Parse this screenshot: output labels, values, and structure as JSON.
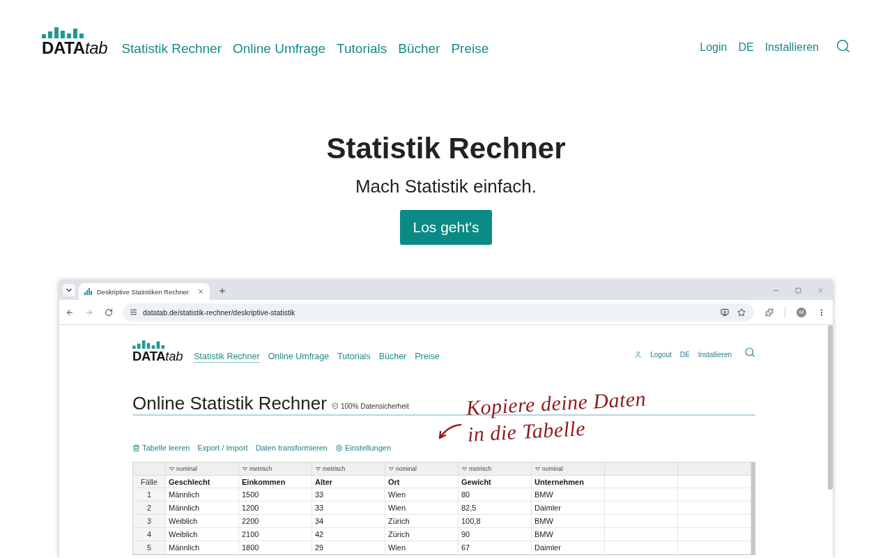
{
  "header": {
    "logo": {
      "bold": "DATA",
      "italic": "tab"
    },
    "nav": [
      "Statistik Rechner",
      "Online Umfrage",
      "Tutorials",
      "Bücher",
      "Preise"
    ],
    "links": [
      "Login",
      "DE",
      "Installieren"
    ]
  },
  "hero": {
    "title": "Statistik Rechner",
    "subtitle": "Mach Statistik einfach.",
    "button": "Los geht's"
  },
  "preview": {
    "browser": {
      "tab_title": "Deskriptive Statistiken Rechner",
      "url": "datatab.de/statistik-rechner/deskriptive-statistik",
      "avatar": "M"
    },
    "page": {
      "logo": {
        "bold": "DATA",
        "italic": "tab"
      },
      "nav": [
        {
          "label": "Statistik Rechner",
          "selected": true
        },
        {
          "label": "Online Umfrage",
          "selected": false
        },
        {
          "label": "Tutorials",
          "selected": false
        },
        {
          "label": "Bücher",
          "selected": false
        },
        {
          "label": "Preise",
          "selected": false
        }
      ],
      "links": [
        {
          "kind": "account",
          "label": "Logout"
        },
        {
          "kind": "link",
          "label": "DE"
        },
        {
          "kind": "link",
          "label": "Installieren"
        }
      ],
      "title": "Online Statistik Rechner",
      "badge": "100% Datensicherheit",
      "note": [
        "Kopiere deine Daten",
        "in die Tabelle"
      ],
      "toolbar": [
        {
          "kind": "trash",
          "label": "Tabelle leeren"
        },
        {
          "kind": "text",
          "label": "Export / Import"
        },
        {
          "kind": "text",
          "label": "Daten transformieren"
        },
        {
          "kind": "settings",
          "label": "Einstellungen"
        }
      ],
      "table": {
        "corner": "Fälle",
        "columns": [
          {
            "type": "nominal",
            "name": "Geschlecht"
          },
          {
            "type": "metrisch",
            "name": "Einkommen"
          },
          {
            "type": "metrisch",
            "name": "Alter"
          },
          {
            "type": "nominal",
            "name": "Ort"
          },
          {
            "type": "metrisch",
            "name": "Gewicht"
          },
          {
            "type": "nominal",
            "name": "Unternehmen"
          }
        ],
        "rows": [
          {
            "number": "1",
            "cells": [
              "Männlich",
              "1500",
              "33",
              "Wien",
              "80",
              "BMW"
            ]
          },
          {
            "number": "2",
            "cells": [
              "Männlich",
              "1200",
              "33",
              "Wien",
              "82,5",
              "Daimler"
            ]
          },
          {
            "number": "3",
            "cells": [
              "Weiblich",
              "2200",
              "34",
              "Zürich",
              "100,8",
              "BMW"
            ]
          },
          {
            "number": "4",
            "cells": [
              "Weiblich",
              "2100",
              "42",
              "Zürich",
              "90",
              "BMW"
            ]
          },
          {
            "number": "5",
            "cells": [
              "Männlich",
              "1800",
              "29",
              "Wien",
              "67",
              "Daimler"
            ]
          }
        ]
      }
    }
  }
}
